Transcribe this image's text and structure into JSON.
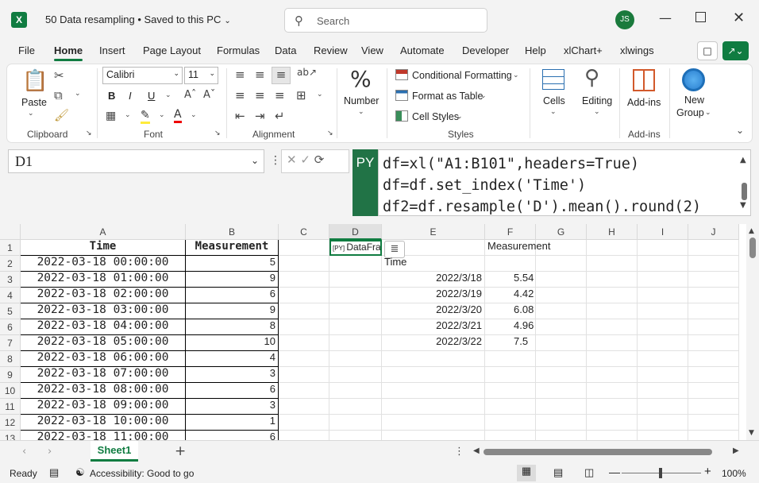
{
  "app": {
    "logo_letter": "X",
    "title": "50 Data resampling • Saved to this PC",
    "avatar": "JS",
    "search_placeholder": "Search"
  },
  "menu": [
    "File",
    "Home",
    "Insert",
    "Page Layout",
    "Formulas",
    "Data",
    "Review",
    "View",
    "Automate",
    "Developer",
    "Help",
    "xlChart+",
    "xlwings"
  ],
  "ribbon": {
    "paste": "Paste",
    "clipboard": "Clipboard",
    "font_name": "Calibri",
    "font_size": "11",
    "bold": "B",
    "italic": "I",
    "underline": "U",
    "font": "Font",
    "alignment": "Alignment",
    "number": "Number",
    "cond_fmt": "Conditional Formatting",
    "format_table": "Format as Table",
    "cell_styles": "Cell Styles",
    "styles": "Styles",
    "cells": "Cells",
    "editing": "Editing",
    "addins": "Add-ins",
    "addins_group": "Add-ins",
    "new_group": "New",
    "new_group2": "Group"
  },
  "formula_bar": {
    "namebox": "D1",
    "py": "PY",
    "formula": "df=xl(\"A1:B101\",headers=True)\ndf=df.set_index('Time')\ndf2=df.resample('D').mean().round(2)"
  },
  "grid": {
    "columns": [
      "A",
      "B",
      "C",
      "D",
      "E",
      "F",
      "G",
      "H",
      "I",
      "J"
    ],
    "rows": [
      "1",
      "2",
      "3",
      "4",
      "5",
      "6",
      "7",
      "8",
      "9",
      "10",
      "11",
      "12",
      "13"
    ],
    "header_a": "Time",
    "header_b": "Measurement",
    "timestamps": [
      "2022-03-18 00:00:00",
      "2022-03-18 01:00:00",
      "2022-03-18 02:00:00",
      "2022-03-18 03:00:00",
      "2022-03-18 04:00:00",
      "2022-03-18 05:00:00",
      "2022-03-18 06:00:00",
      "2022-03-18 07:00:00",
      "2022-03-18 08:00:00",
      "2022-03-18 09:00:00",
      "2022-03-18 10:00:00",
      "2022-03-18 11:00:00"
    ],
    "measurements": [
      "5",
      "9",
      "6",
      "9",
      "8",
      "10",
      "4",
      "3",
      "6",
      "3",
      "1",
      "6"
    ],
    "d1": "DataFrame",
    "out_col_header": "Measurement",
    "index_name": "Time",
    "out_dates": [
      "2022/3/18",
      "2022/3/19",
      "2022/3/20",
      "2022/3/21",
      "2022/3/22"
    ],
    "out_values": [
      "5.54",
      "4.42",
      "6.08",
      "4.96",
      "7.5"
    ]
  },
  "sheet": {
    "tab": "Sheet1",
    "add": "+"
  },
  "status": {
    "ready": "Ready",
    "accessibility": "Accessibility: Good to go",
    "zoom": "100%"
  }
}
